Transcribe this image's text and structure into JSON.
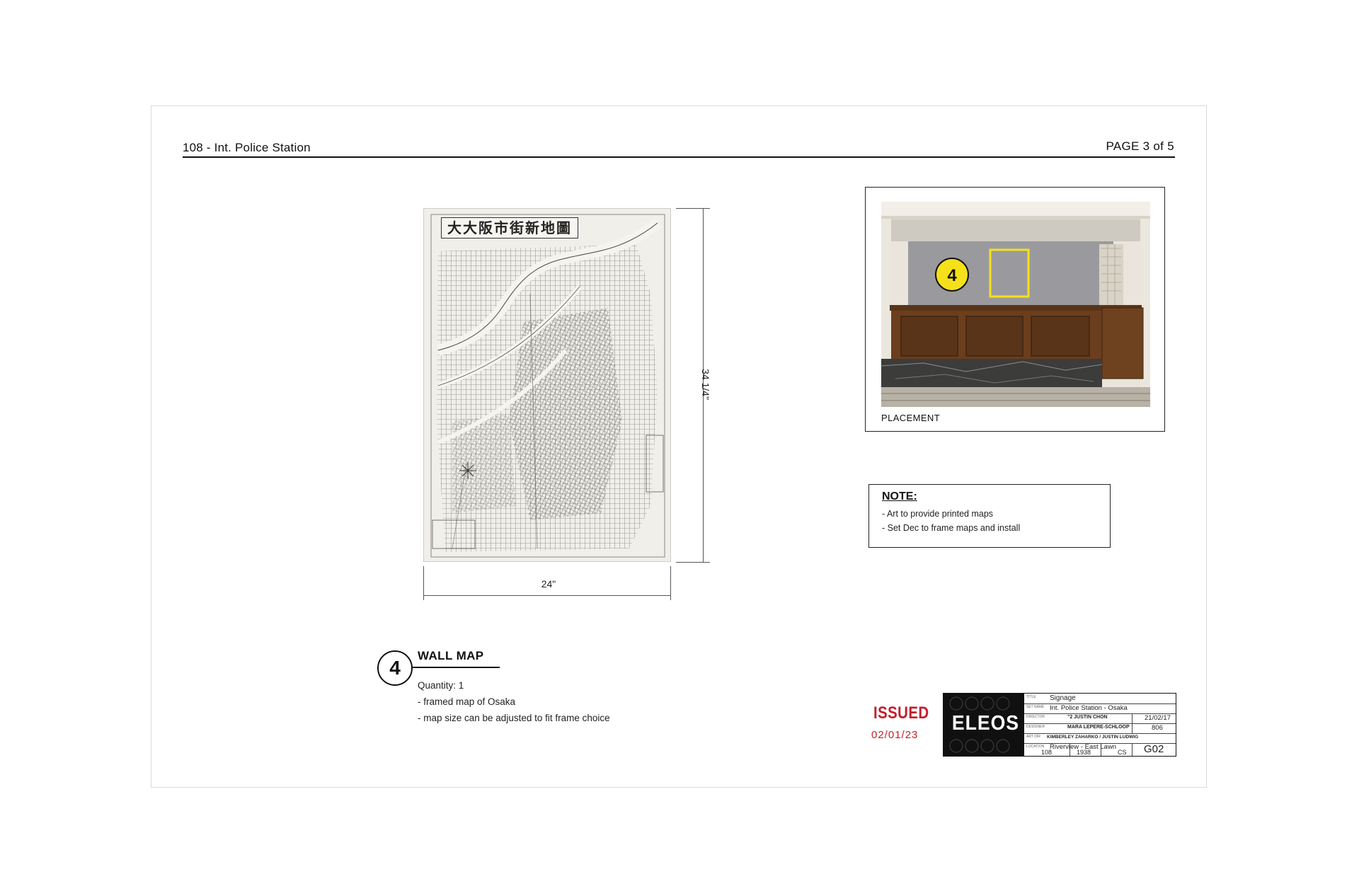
{
  "header": {
    "title": "108 - Int. Police Station",
    "page": "PAGE 3 of 5"
  },
  "map": {
    "title_text": "大大阪市街新地圖",
    "width_label": "24\"",
    "height_label": "34 1/4\""
  },
  "placement": {
    "label": "PLACEMENT",
    "marker_number": "4"
  },
  "note": {
    "title": "NOTE:",
    "lines": [
      "- Art to provide printed maps",
      "- Set Dec to frame maps and install"
    ]
  },
  "callout": {
    "number": "4",
    "title": "WALL MAP",
    "quantity": "Quantity: 1",
    "lines": [
      "- framed map of Osaka",
      "- map size can be adjusted to fit frame choice"
    ]
  },
  "issued": {
    "label": "ISSUED",
    "date": "02/01/23",
    "color": "#c41e2b"
  },
  "title_block": {
    "logo": "ELEOS",
    "title": "Signage",
    "set_name": "Int. Police Station - Osaka",
    "director": "\"2 JUSTIN CHON",
    "date": "21/02/17",
    "designer": "MARA LEPERE-SCHLOOP",
    "set_no": "806",
    "art_director": "KIMBERLEY ZAHARKO / JUSTIN LUDWIG",
    "location": "Riverview - East Lawn",
    "episode": "108",
    "year": "1938",
    "drawn_by": "CS",
    "sheet": "G02"
  },
  "colors": {
    "placement_marker": "#f5e11a",
    "wall": "#9a9a9e",
    "counter": "#5a3418"
  }
}
